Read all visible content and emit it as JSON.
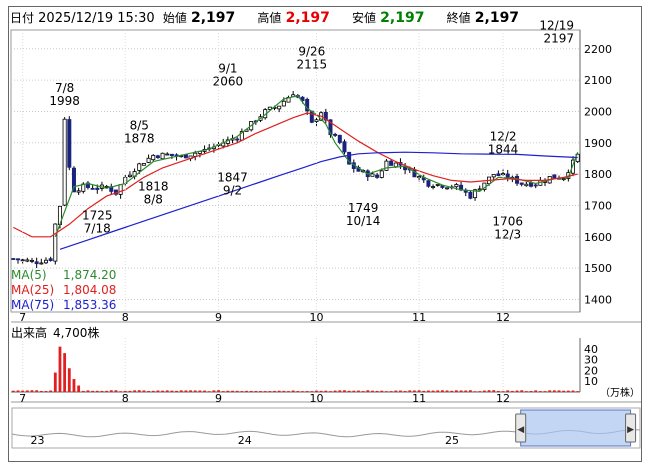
{
  "header": {
    "date_label": "日付",
    "date_value": "2025/12/19 15:30",
    "open_label": "始値",
    "open_value": "2,197",
    "high_label": "高値",
    "high_value": "2,197",
    "low_label": "安値",
    "low_value": "2,197",
    "close_label": "終値",
    "close_value": "2,197",
    "colors": {
      "high": "#e60000",
      "low": "#008000"
    }
  },
  "ma_legend": [
    {
      "label": "MA(5)",
      "value": "1,874.20",
      "color": "#2e8b2e"
    },
    {
      "label": "MA(25)",
      "value": "1,804.08",
      "color": "#e02020"
    },
    {
      "label": "MA(75)",
      "value": "1,853.36",
      "color": "#2020d0"
    }
  ],
  "volume_label": "出来高",
  "volume_value": "4,700株",
  "volume_unit": "（万株）",
  "chart_data": {
    "type": "candlestick",
    "price_axis": {
      "ylim": [
        1360,
        2260
      ],
      "ticks": [
        1400,
        1500,
        1600,
        1700,
        1800,
        1900,
        2000,
        2100,
        2200
      ]
    },
    "month_labels": [
      {
        "label": "7",
        "day": 2
      },
      {
        "label": "8",
        "day": 24
      },
      {
        "label": "9",
        "day": 44
      },
      {
        "label": "10",
        "day": 65
      },
      {
        "label": "11",
        "day": 87
      },
      {
        "label": "12",
        "day": 105
      }
    ],
    "days": 122,
    "anchors": [
      [
        0,
        1530
      ],
      [
        2,
        1525
      ],
      [
        5,
        1520
      ],
      [
        8,
        1530
      ],
      [
        9,
        1640
      ],
      [
        10,
        1700
      ],
      [
        11,
        1980
      ],
      [
        12,
        1820
      ],
      [
        13,
        1750
      ],
      [
        15,
        1760
      ],
      [
        18,
        1755
      ],
      [
        20,
        1760
      ],
      [
        22,
        1740
      ],
      [
        24,
        1790
      ],
      [
        27,
        1830
      ],
      [
        30,
        1860
      ],
      [
        33,
        1862
      ],
      [
        36,
        1855
      ],
      [
        39,
        1868
      ],
      [
        42,
        1880
      ],
      [
        45,
        1900
      ],
      [
        48,
        1920
      ],
      [
        51,
        1960
      ],
      [
        54,
        2000
      ],
      [
        57,
        2020
      ],
      [
        60,
        2060
      ],
      [
        62,
        2030
      ],
      [
        64,
        1960
      ],
      [
        66,
        2000
      ],
      [
        68,
        1930
      ],
      [
        70,
        1900
      ],
      [
        72,
        1830
      ],
      [
        74,
        1810
      ],
      [
        76,
        1800
      ],
      [
        78,
        1790
      ],
      [
        80,
        1840
      ],
      [
        83,
        1830
      ],
      [
        86,
        1800
      ],
      [
        89,
        1770
      ],
      [
        92,
        1765
      ],
      [
        95,
        1760
      ],
      [
        98,
        1730
      ],
      [
        100,
        1760
      ],
      [
        103,
        1800
      ],
      [
        106,
        1790
      ],
      [
        109,
        1770
      ],
      [
        112,
        1770
      ],
      [
        115,
        1790
      ],
      [
        118,
        1790
      ],
      [
        121,
        1860
      ]
    ],
    "ma_series": [
      {
        "name": "MA(5)",
        "color": "#2e8b2e",
        "points": [
          [
            9,
            1600
          ],
          [
            11,
            1680
          ],
          [
            13,
            1760
          ],
          [
            16,
            1770
          ],
          [
            20,
            1755
          ],
          [
            24,
            1770
          ],
          [
            30,
            1840
          ],
          [
            36,
            1860
          ],
          [
            42,
            1880
          ],
          [
            48,
            1920
          ],
          [
            54,
            1990
          ],
          [
            58,
            2040
          ],
          [
            61,
            2050
          ],
          [
            63,
            2010
          ],
          [
            65,
            1990
          ],
          [
            67,
            1960
          ],
          [
            69,
            1900
          ],
          [
            72,
            1840
          ],
          [
            76,
            1800
          ],
          [
            80,
            1820
          ],
          [
            84,
            1825
          ],
          [
            88,
            1790
          ],
          [
            92,
            1765
          ],
          [
            96,
            1750
          ],
          [
            100,
            1745
          ],
          [
            104,
            1790
          ],
          [
            108,
            1785
          ],
          [
            112,
            1770
          ],
          [
            116,
            1785
          ],
          [
            119,
            1790
          ],
          [
            121,
            1870
          ]
        ]
      },
      {
        "name": "MA(25)",
        "color": "#e02020",
        "points": [
          [
            0,
            1630
          ],
          [
            4,
            1600
          ],
          [
            8,
            1600
          ],
          [
            12,
            1640
          ],
          [
            16,
            1690
          ],
          [
            20,
            1730
          ],
          [
            24,
            1750
          ],
          [
            28,
            1790
          ],
          [
            32,
            1820
          ],
          [
            36,
            1840
          ],
          [
            40,
            1860
          ],
          [
            44,
            1880
          ],
          [
            48,
            1900
          ],
          [
            52,
            1930
          ],
          [
            56,
            1955
          ],
          [
            60,
            1980
          ],
          [
            63,
            1995
          ],
          [
            66,
            1985
          ],
          [
            70,
            1945
          ],
          [
            74,
            1905
          ],
          [
            78,
            1870
          ],
          [
            82,
            1840
          ],
          [
            86,
            1815
          ],
          [
            90,
            1795
          ],
          [
            94,
            1780
          ],
          [
            98,
            1775
          ],
          [
            102,
            1780
          ],
          [
            106,
            1785
          ],
          [
            110,
            1780
          ],
          [
            114,
            1780
          ],
          [
            118,
            1790
          ],
          [
            121,
            1800
          ]
        ]
      },
      {
        "name": "MA(75)",
        "color": "#2020d0",
        "points": [
          [
            10,
            1560
          ],
          [
            16,
            1590
          ],
          [
            22,
            1620
          ],
          [
            28,
            1650
          ],
          [
            34,
            1680
          ],
          [
            40,
            1710
          ],
          [
            46,
            1740
          ],
          [
            52,
            1770
          ],
          [
            58,
            1800
          ],
          [
            62,
            1820
          ],
          [
            66,
            1840
          ],
          [
            70,
            1855
          ],
          [
            74,
            1865
          ],
          [
            78,
            1868
          ],
          [
            84,
            1870
          ],
          [
            90,
            1868
          ],
          [
            96,
            1865
          ],
          [
            102,
            1864
          ],
          [
            108,
            1863
          ],
          [
            114,
            1858
          ],
          [
            118,
            1855
          ],
          [
            121,
            1853
          ]
        ]
      }
    ],
    "annotations": [
      {
        "label": "7/8",
        "value": "1998",
        "day": 11,
        "price": 1998,
        "pos": "above"
      },
      {
        "label": "8/5",
        "value": "1878",
        "day": 27,
        "price": 1878,
        "pos": "above"
      },
      {
        "label": "9/1",
        "value": "2060",
        "day": 46,
        "price": 2060,
        "pos": "above"
      },
      {
        "label": "9/26",
        "value": "2115",
        "day": 64,
        "price": 2115,
        "pos": "above"
      },
      {
        "label": "12/2",
        "value": "1844",
        "day": 105,
        "price": 1844,
        "pos": "above"
      },
      {
        "label": "12/19",
        "value": "2197",
        "day": 119,
        "price": 2197,
        "pos": "above"
      },
      {
        "label": "7/18",
        "value": "1725",
        "day": 18,
        "price": 1725,
        "pos": "below"
      },
      {
        "label": "8/8",
        "value": "1818",
        "day": 30,
        "price": 1818,
        "pos": "below"
      },
      {
        "label": "9/2",
        "value": "1847",
        "day": 47,
        "price": 1847,
        "pos": "below"
      },
      {
        "label": "10/14",
        "value": "1749",
        "day": 75,
        "price": 1749,
        "pos": "below"
      },
      {
        "label": "12/3",
        "value": "1706",
        "day": 106,
        "price": 1706,
        "pos": "below"
      }
    ],
    "volume_axis": {
      "ylim": [
        0,
        50
      ],
      "ticks": [
        10,
        20,
        30,
        40
      ]
    },
    "volume_spikes": [
      [
        9,
        18
      ],
      [
        10,
        42
      ],
      [
        11,
        36
      ],
      [
        12,
        22
      ],
      [
        13,
        12
      ],
      [
        14,
        6
      ]
    ],
    "volume_base": 1.2,
    "navigator_labels": [
      {
        "label": "23",
        "x": 0.02
      },
      {
        "label": "24",
        "x": 0.35
      },
      {
        "label": "25",
        "x": 0.68
      }
    ],
    "navigator_window": [
      0.81,
      0.985
    ]
  }
}
